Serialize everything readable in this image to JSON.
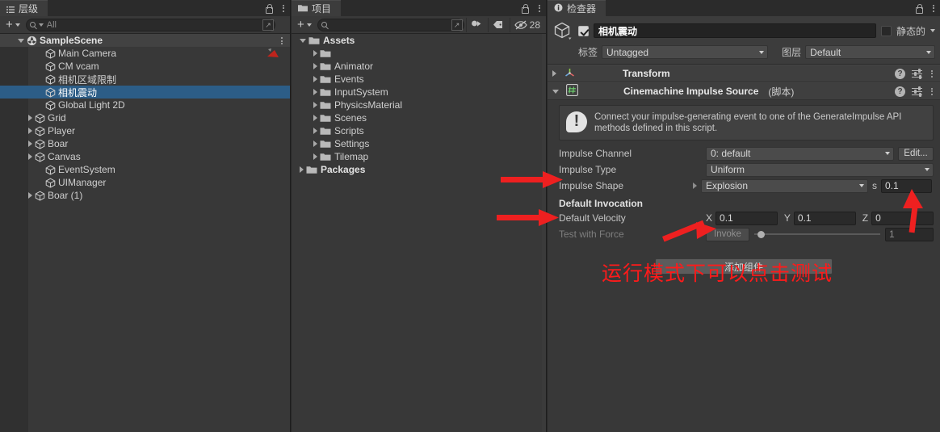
{
  "colors": {
    "accent_selection": "#2c5d87",
    "annotation_red": "#ff1a1a",
    "panel_bg": "#383838",
    "header_bg": "#3f3f3f"
  },
  "hierarchy": {
    "tab_label": "层级",
    "toolbar": {
      "add_label": "+",
      "search_placeholder": "All"
    },
    "scene": {
      "label": "SampleScene",
      "expanded": true
    },
    "items": [
      {
        "label": "Main Camera",
        "indent": 2,
        "arrow": "none",
        "selected": false,
        "badge": "camera-badge"
      },
      {
        "label": "CM vcam",
        "indent": 2,
        "arrow": "none",
        "selected": false
      },
      {
        "label": "相机区域限制",
        "indent": 2,
        "arrow": "none",
        "selected": false
      },
      {
        "label": "相机震动",
        "indent": 2,
        "arrow": "none",
        "selected": true
      },
      {
        "label": "Global Light 2D",
        "indent": 2,
        "arrow": "none",
        "selected": false
      },
      {
        "label": "Grid",
        "indent": 1,
        "arrow": "closed",
        "selected": false
      },
      {
        "label": "Player",
        "indent": 1,
        "arrow": "closed",
        "selected": false
      },
      {
        "label": "Boar",
        "indent": 1,
        "arrow": "closed",
        "selected": false
      },
      {
        "label": "Canvas",
        "indent": 1,
        "arrow": "closed",
        "selected": false
      },
      {
        "label": "EventSystem",
        "indent": 2,
        "arrow": "none",
        "selected": false
      },
      {
        "label": "UIManager",
        "indent": 2,
        "arrow": "none",
        "selected": false
      },
      {
        "label": "Boar (1)",
        "indent": 1,
        "arrow": "closed",
        "selected": false
      }
    ]
  },
  "project": {
    "tab_label": "项目",
    "toolbar": {
      "add_label": "+",
      "search_placeholder": "",
      "hidden_count": "28"
    },
    "tree": [
      {
        "label": "Assets",
        "indent": 0,
        "arrow": "open",
        "bold": true
      },
      {
        "label": "",
        "indent": 1,
        "arrow": "closed",
        "bold": false
      },
      {
        "label": "Animator",
        "indent": 1,
        "arrow": "closed",
        "bold": false
      },
      {
        "label": "Events",
        "indent": 1,
        "arrow": "closed",
        "bold": false
      },
      {
        "label": "InputSystem",
        "indent": 1,
        "arrow": "closed",
        "bold": false
      },
      {
        "label": "PhysicsMaterial",
        "indent": 1,
        "arrow": "closed",
        "bold": false
      },
      {
        "label": "Scenes",
        "indent": 1,
        "arrow": "closed",
        "bold": false
      },
      {
        "label": "Scripts",
        "indent": 1,
        "arrow": "closed",
        "bold": false
      },
      {
        "label": "Settings",
        "indent": 1,
        "arrow": "closed",
        "bold": false
      },
      {
        "label": "Tilemap",
        "indent": 1,
        "arrow": "closed",
        "bold": false
      },
      {
        "label": "Packages",
        "indent": 0,
        "arrow": "closed",
        "bold": true
      }
    ]
  },
  "inspector": {
    "tab_label": "检查器",
    "object": {
      "enabled": true,
      "name": "相机震动",
      "static_label": "静态的",
      "static_checked": false,
      "tag_label": "标签",
      "tag_value": "Untagged",
      "layer_label": "图层",
      "layer_value": "Default"
    },
    "components": [
      {
        "name": "transform",
        "title": "Transform",
        "subtitle": "",
        "expanded": false
      },
      {
        "name": "cinemachine-impulse-source",
        "title": "Cinemachine Impulse Source",
        "subtitle": "(脚本)",
        "expanded": true
      }
    ],
    "impulse": {
      "helpbox": "Connect your impulse-generating event to one of the GenerateImpulse API methods defined in this script.",
      "channel_label": "Impulse Channel",
      "channel_value": "0: default",
      "channel_edit_label": "Edit...",
      "type_label": "Impulse Type",
      "type_value": "Uniform",
      "shape_label": "Impulse Shape",
      "shape_value": "Explosion",
      "shape_unit": "s",
      "shape_duration": "0.1",
      "section_title": "Default Invocation",
      "velocity_label": "Default Velocity",
      "velocity_x_axis": "X",
      "velocity_x": "0.1",
      "velocity_y_axis": "Y",
      "velocity_y": "0.1",
      "velocity_z_axis": "Z",
      "velocity_z": "0",
      "test_label": "Test with Force",
      "invoke_label": "Invoke",
      "force_value": "1"
    },
    "add_component_label": "添加组件"
  },
  "annotations": {
    "note_text": "运行模式下可以点击测试",
    "arrows": [
      {
        "name": "arrow-impulse-shape",
        "direction": "right"
      },
      {
        "name": "arrow-default-velocity",
        "direction": "right"
      },
      {
        "name": "arrow-invoke",
        "direction": "up-right"
      },
      {
        "name": "arrow-shape-duration",
        "direction": "up"
      }
    ]
  }
}
